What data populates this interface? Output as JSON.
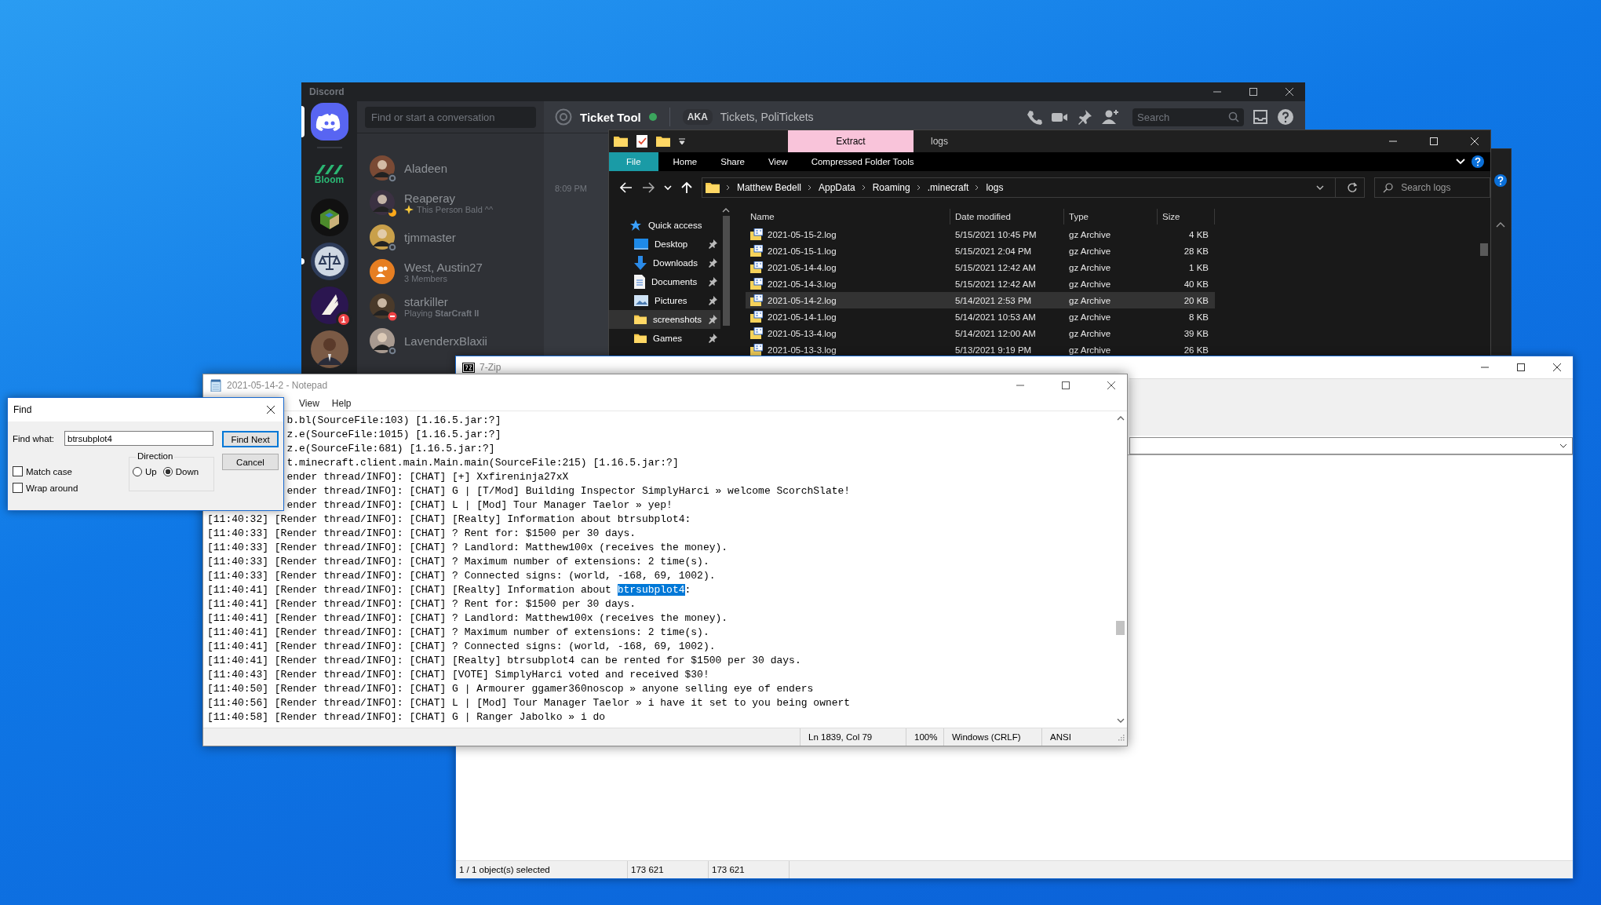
{
  "discord": {
    "title": "Discord",
    "servers": [
      {
        "kind": "home",
        "selected": true,
        "unread": false
      },
      {
        "kind": "stripes",
        "label": "Bloom",
        "selected": false,
        "unread": false
      },
      {
        "kind": "globe",
        "selected": false,
        "unread": false
      },
      {
        "kind": "seal",
        "selected": false,
        "unread": true
      },
      {
        "kind": "wing",
        "badge": "1",
        "selected": false,
        "unread": false
      },
      {
        "kind": "portrait",
        "selected": false,
        "unread": false
      }
    ],
    "search": {
      "placeholder": "Find or start a conversation"
    },
    "conversations": [
      {
        "name": "Aladeen",
        "kind": "user",
        "offline": true,
        "idle": false,
        "dnd": false,
        "status_emoji": false
      },
      {
        "name": "Reaperay",
        "subtitle": "This Person Bald ^^",
        "kind": "user",
        "offline": false,
        "idle": true,
        "dnd": false,
        "status_emoji": true
      },
      {
        "name": "tjmmaster",
        "kind": "user",
        "offline": true,
        "idle": false,
        "dnd": false,
        "status_emoji": false
      },
      {
        "name": "West, Austin27",
        "subtitle": "3 Members",
        "kind": "group",
        "offline": false,
        "idle": false,
        "dnd": false,
        "status_emoji": false
      },
      {
        "name": "starkiller",
        "subtitle": "Playing **StarCraft II**",
        "kind": "user",
        "offline": false,
        "idle": false,
        "dnd": true,
        "status_emoji": false
      },
      {
        "name": "LavenderxBlaxii",
        "kind": "user",
        "offline": true,
        "idle": false,
        "dnd": false,
        "status_emoji": false
      }
    ],
    "chat": {
      "recipient": "Ticket Tool",
      "online": true,
      "aka_label": "AKA",
      "aka": "Tickets, PoliTickets",
      "search_placeholder": "Search",
      "timestamp": "8:09 PM"
    }
  },
  "explorer": {
    "context_tab": "Extract",
    "title": "logs",
    "ribbon_tabs": [
      {
        "label": "File",
        "selected": true
      },
      {
        "label": "Home",
        "selected": false
      },
      {
        "label": "Share",
        "selected": false
      },
      {
        "label": "View",
        "selected": false
      },
      {
        "label": "Compressed Folder Tools",
        "selected": false
      }
    ],
    "breadcrumb": [
      "Matthew Bedell",
      "AppData",
      "Roaming",
      ".minecraft",
      "logs"
    ],
    "search_placeholder": "Search logs",
    "nav": [
      {
        "label": "Quick access",
        "kind": "star",
        "pinned": false,
        "selected": false
      },
      {
        "label": "Desktop",
        "kind": "desktop",
        "pinned": true,
        "selected": false
      },
      {
        "label": "Downloads",
        "kind": "download",
        "pinned": true,
        "selected": false
      },
      {
        "label": "Documents",
        "kind": "document",
        "pinned": true,
        "selected": false
      },
      {
        "label": "Pictures",
        "kind": "pictures",
        "pinned": true,
        "selected": false
      },
      {
        "label": "screenshots",
        "kind": "folder",
        "pinned": true,
        "selected": true
      },
      {
        "label": "Games",
        "kind": "folder",
        "pinned": true,
        "selected": false
      }
    ],
    "columns": [
      "Name",
      "Date modified",
      "Type",
      "Size"
    ],
    "files": [
      {
        "name": "2021-05-15-2.log",
        "date": "5/15/2021 10:45 PM",
        "type": "gz Archive",
        "size": "4 KB",
        "selected": false
      },
      {
        "name": "2021-05-15-1.log",
        "date": "5/15/2021 2:04 PM",
        "type": "gz Archive",
        "size": "28 KB",
        "selected": false
      },
      {
        "name": "2021-05-14-4.log",
        "date": "5/15/2021 12:42 AM",
        "type": "gz Archive",
        "size": "1 KB",
        "selected": false
      },
      {
        "name": "2021-05-14-3.log",
        "date": "5/15/2021 12:42 AM",
        "type": "gz Archive",
        "size": "40 KB",
        "selected": false
      },
      {
        "name": "2021-05-14-2.log",
        "date": "5/14/2021 2:53 PM",
        "type": "gz Archive",
        "size": "20 KB",
        "selected": true
      },
      {
        "name": "2021-05-14-1.log",
        "date": "5/14/2021 10:53 AM",
        "type": "gz Archive",
        "size": "8 KB",
        "selected": false
      },
      {
        "name": "2021-05-13-4.log",
        "date": "5/14/2021 12:00 AM",
        "type": "gz Archive",
        "size": "39 KB",
        "selected": false
      },
      {
        "name": "2021-05-13-3.log",
        "date": "5/13/2021 9:19 PM",
        "type": "gz Archive",
        "size": "26 KB",
        "selected": false
      }
    ]
  },
  "seven_zip": {
    "title": "7-Zip",
    "status": [
      "1 / 1 object(s) selected",
      "173 621",
      "173 621"
    ]
  },
  "notepad": {
    "title": "2021-05-14-2 - Notepad",
    "menu": [
      "View",
      "Help"
    ],
    "lines": [
      {
        "kind": "clipped",
        "text": "b.bl(SourceFile:103) [1.16.5.jar:?]"
      },
      {
        "kind": "clipped",
        "text": "z.e(SourceFile:1015) [1.16.5.jar:?]"
      },
      {
        "kind": "clipped",
        "text": "z.e(SourceFile:681) [1.16.5.jar:?]"
      },
      {
        "kind": "clipped",
        "text": "t.minecraft.client.main.Main.main(SourceFile:215) [1.16.5.jar:?]"
      },
      {
        "kind": "clipped",
        "text": "ender thread/INFO]: [CHAT] [+] Xxfireninja27xX"
      },
      {
        "kind": "clipped",
        "text": "ender thread/INFO]: [CHAT] G | [T/Mod] Building Inspector SimplyHarci » welcome ScorchSlate!"
      },
      {
        "kind": "clipped",
        "text": "ender thread/INFO]: [CHAT] L | [Mod] Tour Manager Taelor » yep!"
      },
      {
        "kind": "full",
        "text": "[11:40:32] [Render thread/INFO]: [CHAT] [Realty] Information about btrsubplot4:"
      },
      {
        "kind": "full",
        "text": "[11:40:33] [Render thread/INFO]: [CHAT] ? Rent for: $1500 per 30 days."
      },
      {
        "kind": "full",
        "text": "[11:40:33] [Render thread/INFO]: [CHAT] ? Landlord: Matthew100x (receives the money)."
      },
      {
        "kind": "full",
        "text": "[11:40:33] [Render thread/INFO]: [CHAT] ? Maximum number of extensions: 2 time(s)."
      },
      {
        "kind": "full",
        "text": "[11:40:33] [Render thread/INFO]: [CHAT] ? Connected signs: (world, -168, 69, 1002)."
      },
      {
        "kind": "full",
        "text": "[11:40:41] [Render thread/INFO]: [CHAT] [Realty] Information about ",
        "selection": "btrsubplot4",
        "rest": ":"
      },
      {
        "kind": "full",
        "text": "[11:40:41] [Render thread/INFO]: [CHAT] ? Rent for: $1500 per 30 days."
      },
      {
        "kind": "full",
        "text": "[11:40:41] [Render thread/INFO]: [CHAT] ? Landlord: Matthew100x (receives the money)."
      },
      {
        "kind": "full",
        "text": "[11:40:41] [Render thread/INFO]: [CHAT] ? Maximum number of extensions: 2 time(s)."
      },
      {
        "kind": "full",
        "text": "[11:40:41] [Render thread/INFO]: [CHAT] ? Connected signs: (world, -168, 69, 1002)."
      },
      {
        "kind": "full",
        "text": "[11:40:41] [Render thread/INFO]: [CHAT] [Realty] btrsubplot4 can be rented for $1500 per 30 days."
      },
      {
        "kind": "full",
        "text": "[11:40:43] [Render thread/INFO]: [CHAT] [VOTE] SimplyHarci voted and received $30!"
      },
      {
        "kind": "full",
        "text": "[11:40:50] [Render thread/INFO]: [CHAT] G | Armourer ggamer360noscop » anyone selling eye of enders"
      },
      {
        "kind": "full",
        "text": "[11:40:56] [Render thread/INFO]: [CHAT] L | [Mod] Tour Manager Taelor » i have it set to you being ownert"
      },
      {
        "kind": "full",
        "text": "[11:40:58] [Render thread/INFO]: [CHAT] G | Ranger Jabolko » i do"
      }
    ],
    "status": {
      "position": "Ln 1839, Col 79",
      "zoom": "100%",
      "line_endings": "Windows (CRLF)",
      "encoding": "ANSI"
    }
  },
  "find_dialog": {
    "title": "Find",
    "find_what_label": "Find what:",
    "query": "btrsubplot4",
    "find_next": "Find Next",
    "cancel": "Cancel",
    "direction_label": "Direction",
    "directions": [
      {
        "label": "Up",
        "selected": false
      },
      {
        "label": "Down",
        "selected": true
      }
    ],
    "options": [
      {
        "label": "Match case",
        "checked": false
      },
      {
        "label": "Wrap around",
        "checked": false
      }
    ]
  }
}
